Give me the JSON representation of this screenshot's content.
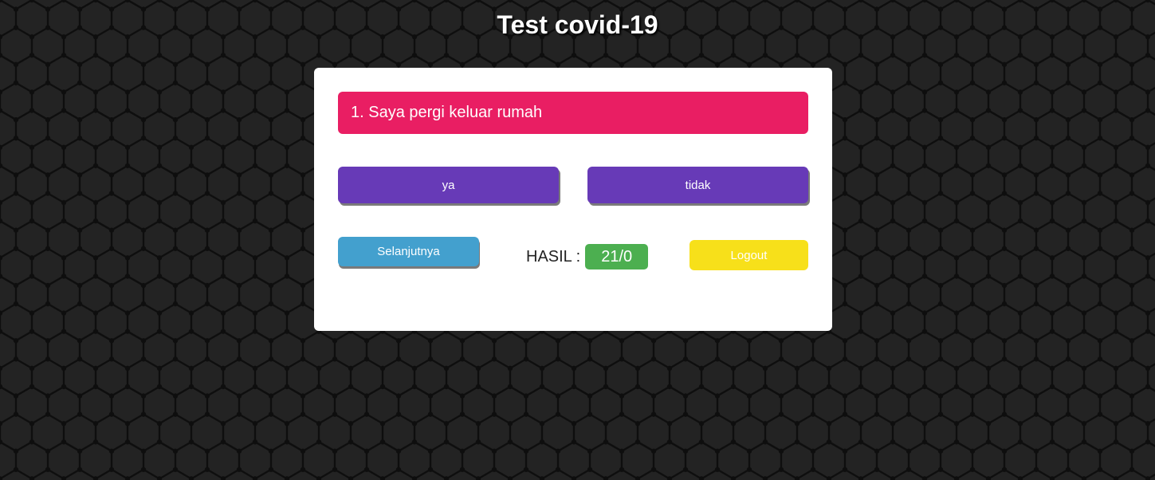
{
  "page": {
    "title": "Test covid-19"
  },
  "question": {
    "text": "1. Saya pergi keluar rumah"
  },
  "answers": {
    "yes_label": "ya",
    "no_label": "tidak"
  },
  "controls": {
    "next_label": "Selanjutnya",
    "logout_label": "Logout"
  },
  "result": {
    "label": "HASIL :",
    "value": "21/0"
  },
  "colors": {
    "background": "#232323",
    "pattern_line": "#0e0e0e",
    "question_bg": "#e91e63",
    "answer_bg": "#673ab7",
    "next_bg": "#43a0ce",
    "result_bg": "#4caf50",
    "logout_bg": "#f7e01a"
  },
  "background_pattern": "hexagonal-cube-lattice"
}
